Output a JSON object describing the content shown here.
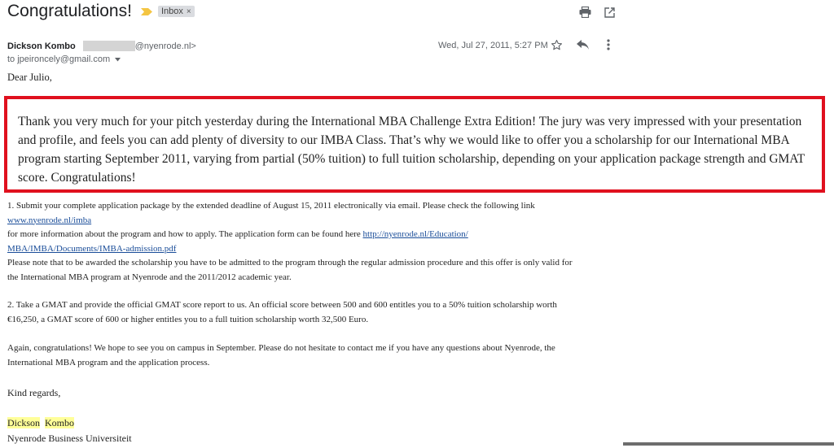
{
  "email": {
    "subject": "Congratulations!",
    "label_chip": "Inbox",
    "label_chip_close": "×",
    "sender_name": "Dickson Kombo",
    "sender_email_suffix": "@nyenrode.nl>",
    "to_line": "to jpeironcely@gmail.com",
    "date": "Wed, Jul 27, 2011, 5:27 PM",
    "greeting": "Dear Julio,",
    "highlight_text": "Thank you very much for your pitch yesterday during the International MBA Challenge Extra Edition! The jury was very impressed with your presentation and profile, and feels you can add plenty of diversity to our IMBA Class. That’s why we would like to offer you a scholarship for our International MBA program starting September 2011, varying from partial (50% tuition) to full tuition scholarship, depending on your application package strength and GMAT score. Congratulations!",
    "p1_line1": "1. Submit your complete application package by the extended deadline of August 15, 2011 electronically via email. Please check the following link",
    "p1_link1": "www.nyenrode.nl/imba",
    "p1_line2": "for more information about the program and how to apply. The application form can be found here ",
    "p1_link2a": "http://nyenrode.nl/Education/",
    "p1_link2b": "MBA/IMBA/Documents/IMBA-admission.pdf",
    "p1_line3": "Please note that to be awarded the scholarship you have to be admitted to the program through the regular admission procedure and this offer is only valid for",
    "p1_line4": "the International MBA program at Nyenrode and the 2011/2012 academic year.",
    "p2_line1": "2. Take a GMAT and provide the official GMAT score report to us.  An official score between 500 and 600 entitles you to a 50% tuition scholarship worth",
    "p2_line2": "€16,250, a GMAT score of 600 or higher entitles you to a full tuition scholarship worth 32,500 Euro.",
    "p3_line1": "Again, congratulations! We hope to see you on campus in September. Please do not hesitate to contact me if you have any questions about Nyenrode, the",
    "p3_line2": "International MBA program and the application process.",
    "closing": "Kind regards,",
    "sig_first": "Dickson",
    "sig_last": "Kombo",
    "sig_org": "Nyenrode Business Universiteit"
  },
  "icons": {
    "print": "print-icon",
    "open_new_window": "open-in-new-icon",
    "star": "star-icon",
    "reply": "reply-icon",
    "more": "more-vert-icon",
    "label_marker": "label-important-icon",
    "dropdown": "chevron-down-icon"
  },
  "colors": {
    "highlight_border": "#e0101e",
    "label_marker": "#f4c542",
    "link": "#1a4d99",
    "name_highlight": "#ffff99"
  }
}
